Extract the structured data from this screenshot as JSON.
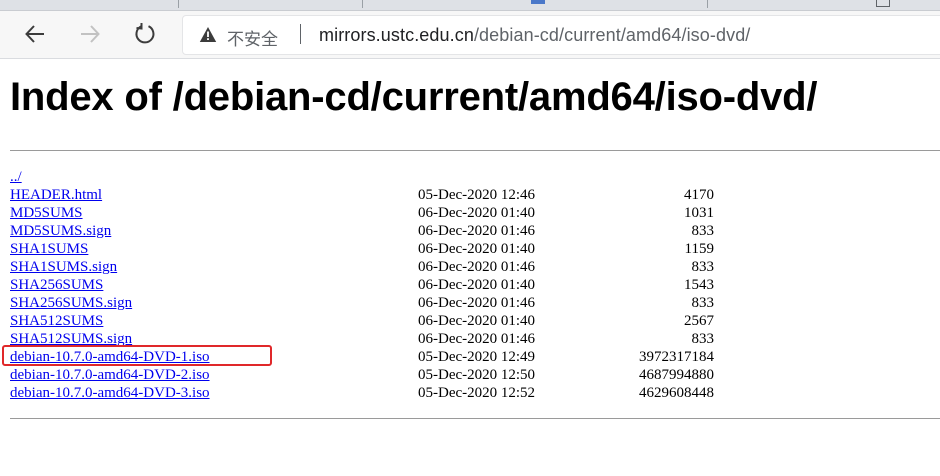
{
  "browser": {
    "not_secure_label": "不安全",
    "url_host": "mirrors.ustc.edu.cn",
    "url_path": "/debian-cd/current/amd64/iso-dvd/",
    "icons": {
      "back": "back-arrow-icon",
      "forward": "forward-arrow-icon",
      "reload": "reload-icon",
      "warning": "warning-triangle-icon"
    }
  },
  "page": {
    "title": "Index of /debian-cd/current/amd64/iso-dvd/",
    "parent_link": "../",
    "files": [
      {
        "name": "HEADER.html",
        "date": "05-Dec-2020 12:46",
        "size": "4170"
      },
      {
        "name": "MD5SUMS",
        "date": "06-Dec-2020 01:40",
        "size": "1031"
      },
      {
        "name": "MD5SUMS.sign",
        "date": "06-Dec-2020 01:46",
        "size": "833"
      },
      {
        "name": "SHA1SUMS",
        "date": "06-Dec-2020 01:40",
        "size": "1159"
      },
      {
        "name": "SHA1SUMS.sign",
        "date": "06-Dec-2020 01:46",
        "size": "833"
      },
      {
        "name": "SHA256SUMS",
        "date": "06-Dec-2020 01:40",
        "size": "1543"
      },
      {
        "name": "SHA256SUMS.sign",
        "date": "06-Dec-2020 01:46",
        "size": "833"
      },
      {
        "name": "SHA512SUMS",
        "date": "06-Dec-2020 01:40",
        "size": "2567"
      },
      {
        "name": "SHA512SUMS.sign",
        "date": "06-Dec-2020 01:46",
        "size": "833"
      },
      {
        "name": "debian-10.7.0-amd64-DVD-1.iso",
        "date": "05-Dec-2020 12:49",
        "size": "3972317184",
        "highlighted": true
      },
      {
        "name": "debian-10.7.0-amd64-DVD-2.iso",
        "date": "05-Dec-2020 12:50",
        "size": "4687994880"
      },
      {
        "name": "debian-10.7.0-amd64-DVD-3.iso",
        "date": "05-Dec-2020 12:52",
        "size": "4629608448"
      }
    ]
  },
  "colors": {
    "link": "#0000ee",
    "highlight_border": "#e0282a"
  }
}
